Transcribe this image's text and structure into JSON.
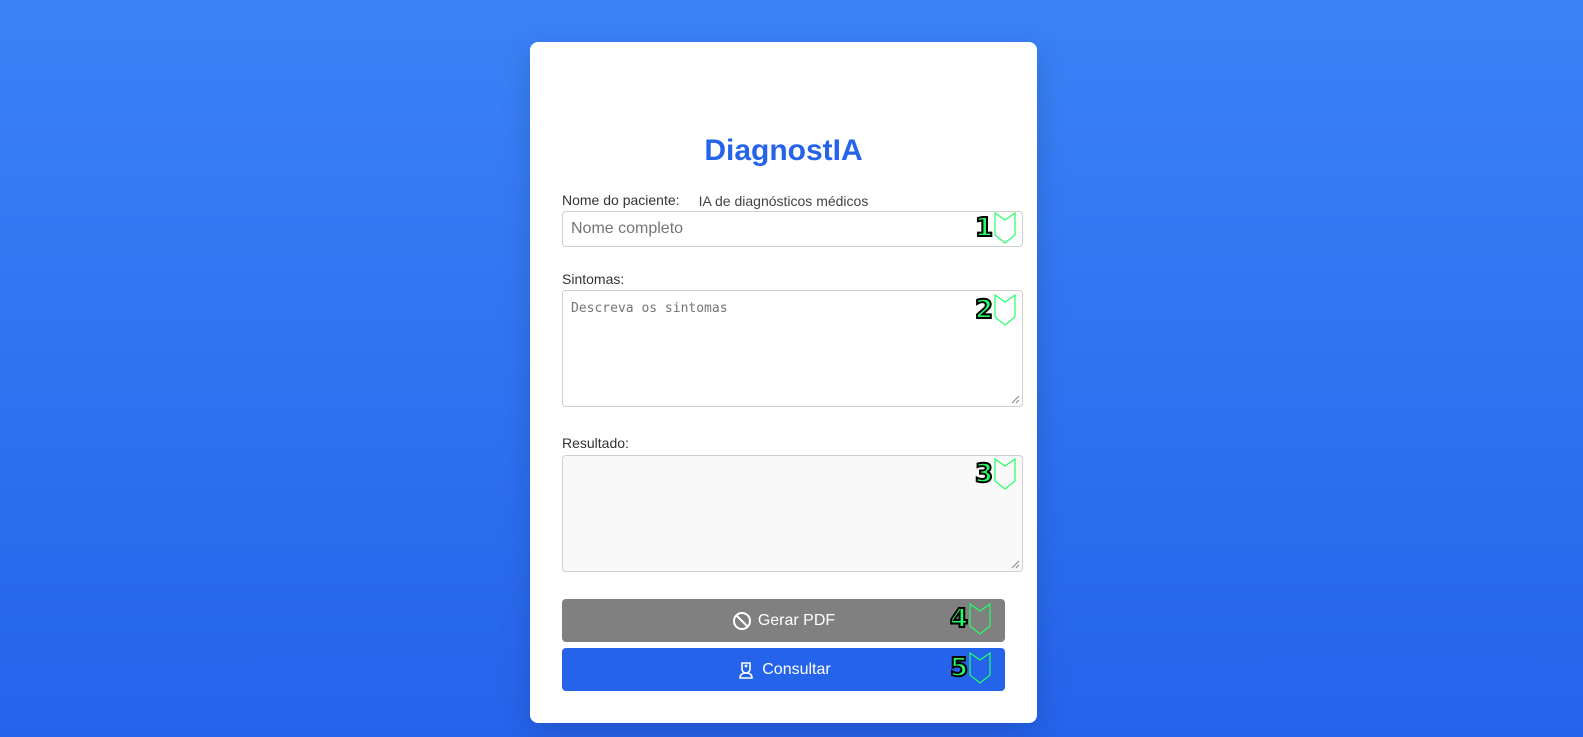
{
  "app": {
    "title": "DiagnostIA",
    "subtitle": "IA de diagnósticos médicos"
  },
  "form": {
    "nome_label": "Nome do paciente:",
    "nome_placeholder": "Nome completo",
    "nome_value": "",
    "sintomas_label": "Sintomas:",
    "sintomas_placeholder": "Descreva os sintomas",
    "sintomas_value": "",
    "resultado_label": "Resultado:",
    "resultado_value": ""
  },
  "buttons": {
    "pdf_label": "Gerar PDF",
    "pdf_icon": "prohibited-icon",
    "consult_label": "Consultar",
    "consult_icon": "doctor-icon"
  },
  "markers": [
    "1",
    "2",
    "3",
    "4",
    "5"
  ],
  "colors": {
    "background": "#3b82f6",
    "accent": "#2563eb",
    "disabled_button": "#808080",
    "marker": "#22ff66"
  }
}
